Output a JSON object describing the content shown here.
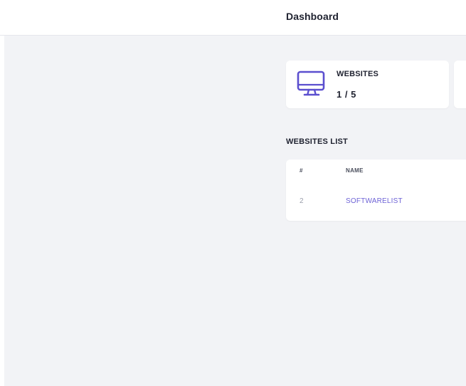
{
  "header": {
    "title": "Dashboard"
  },
  "stats": {
    "websites_label": "WEBSITES",
    "websites_value": "1 / 5",
    "icon": "monitor-icon",
    "accent_color": "#5b4fcf"
  },
  "websites_list": {
    "title": "WEBSITES LIST",
    "columns": [
      "#",
      "NAME"
    ],
    "rows": [
      {
        "num": "2",
        "name": "SOFTWARELIST"
      }
    ],
    "link_color": "#6e63d6"
  }
}
